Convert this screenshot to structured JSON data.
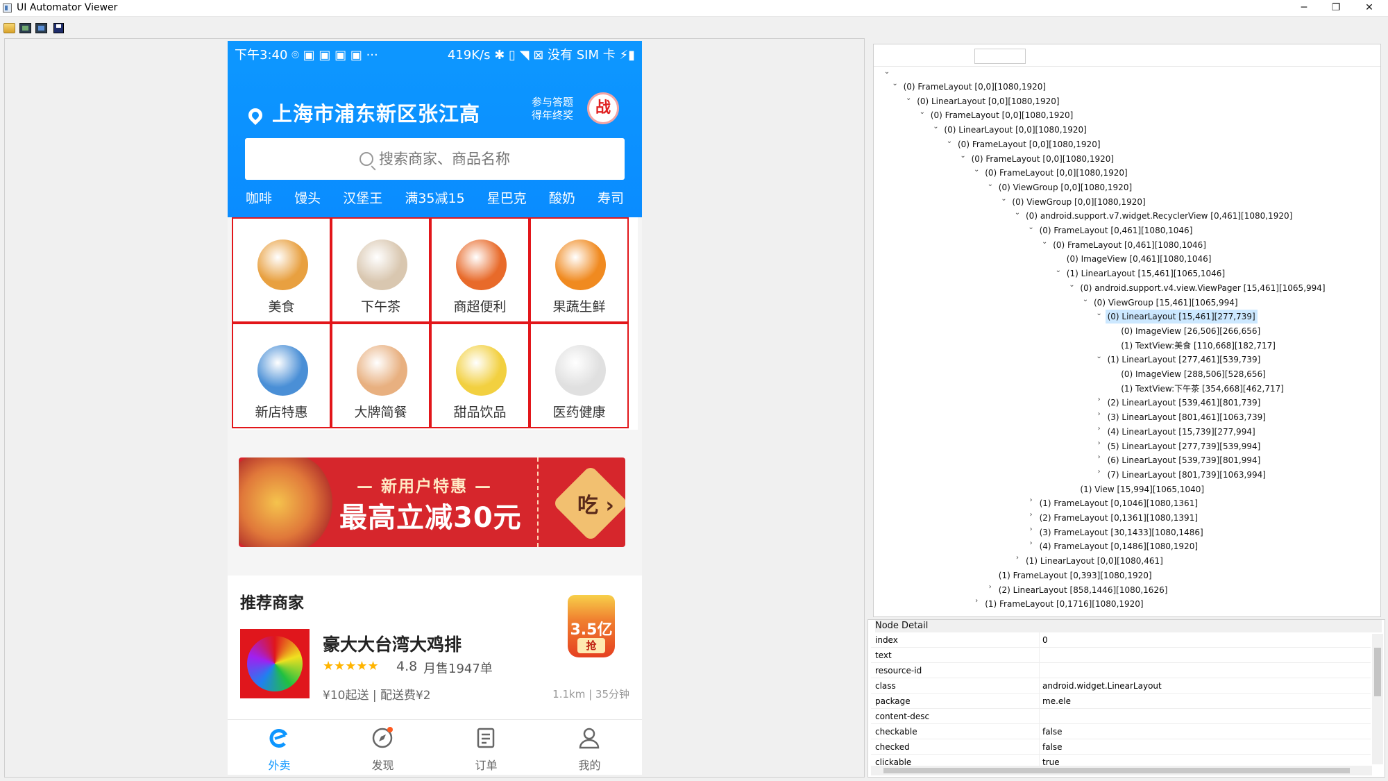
{
  "window": {
    "title": "UI Automator Viewer",
    "minimize": "─",
    "restore": "❐",
    "close": "✕"
  },
  "toolbar": {
    "icons": [
      "open-folder-icon",
      "device-screenshot-icon",
      "device-screenshot-compressed-icon",
      "save-icon"
    ]
  },
  "phone": {
    "status_left": "下午3:40  ⌾  ▣  ▣  ▣  ▣  ···",
    "status_right": "419K/s  ✱  ▯  ◥  ⊠  没有 SIM 卡  ⚡▮",
    "location": "上海市浦东新区张江高",
    "promo_line1": "参与答题",
    "promo_line2": "得年终奖",
    "promo_badge": "战",
    "search_placeholder": "搜索商家、商品名称",
    "hot_keywords": [
      "咖啡",
      "馒头",
      "汉堡王",
      "满35减15",
      "星巴克",
      "酸奶",
      "寿司"
    ],
    "categories": [
      {
        "label": "美食",
        "color": "#e8a040"
      },
      {
        "label": "下午茶",
        "color": "#d9c7b0"
      },
      {
        "label": "商超便利",
        "color": "#e86a2a"
      },
      {
        "label": "果蔬生鲜",
        "color": "#f08a20"
      },
      {
        "label": "新店特惠",
        "color": "#4a8fd6"
      },
      {
        "label": "大牌简餐",
        "color": "#e8b080"
      },
      {
        "label": "甜品饮品",
        "color": "#f2d040"
      },
      {
        "label": "医药健康",
        "color": "#e0e0e0"
      }
    ],
    "banner": {
      "sub": "— 新用户特惠 —",
      "main": "最高立减30元",
      "action": "吃 ›"
    },
    "recommend": {
      "title": "推荐商家",
      "shop_name": "豪大大台湾大鸡排",
      "stars": "★★★★★",
      "rating": "4.8",
      "sales": "月售1947单",
      "min_info": "¥10起送 | 配送费¥2",
      "distance": "1.1km | 35分钟",
      "redpacket_value": "3.5亿",
      "redpacket_action": "抢"
    },
    "tabs": [
      {
        "label": "外卖",
        "color": "#0d96ff"
      },
      {
        "label": "发现",
        "color": "#666666"
      },
      {
        "label": "订单",
        "color": "#666666"
      },
      {
        "label": "我的",
        "color": "#666666"
      }
    ]
  },
  "tree": {
    "root_toggle": "⌄",
    "nodes": [
      {
        "text": "(0) FrameLayout [0,0][1080,1920]",
        "depth": 1,
        "tw": "⌄"
      },
      {
        "text": "(0) LinearLayout [0,0][1080,1920]",
        "depth": 2,
        "tw": "⌄"
      },
      {
        "text": "(0) FrameLayout [0,0][1080,1920]",
        "depth": 3,
        "tw": "⌄"
      },
      {
        "text": "(0) LinearLayout [0,0][1080,1920]",
        "depth": 4,
        "tw": "⌄"
      },
      {
        "text": "(0) FrameLayout [0,0][1080,1920]",
        "depth": 5,
        "tw": "⌄"
      },
      {
        "text": "(0) FrameLayout [0,0][1080,1920]",
        "depth": 6,
        "tw": "⌄"
      },
      {
        "text": "(0) FrameLayout [0,0][1080,1920]",
        "depth": 7,
        "tw": "⌄"
      },
      {
        "text": "(0) ViewGroup [0,0][1080,1920]",
        "depth": 8,
        "tw": "⌄"
      },
      {
        "text": "(0) ViewGroup [0,0][1080,1920]",
        "depth": 9,
        "tw": "⌄"
      },
      {
        "text": "(0) android.support.v7.widget.RecyclerView [0,461][1080,1920]",
        "depth": 10,
        "tw": "⌄"
      },
      {
        "text": "(0) FrameLayout [0,461][1080,1046]",
        "depth": 11,
        "tw": "⌄"
      },
      {
        "text": "(0) FrameLayout [0,461][1080,1046]",
        "depth": 12,
        "tw": "⌄"
      },
      {
        "text": "(0) ImageView [0,461][1080,1046]",
        "depth": 13,
        "tw": ""
      },
      {
        "text": "(1) LinearLayout [15,461][1065,1046]",
        "depth": 13,
        "tw": "⌄"
      },
      {
        "text": "(0) android.support.v4.view.ViewPager [15,461][1065,994]",
        "depth": 14,
        "tw": "⌄"
      },
      {
        "text": "(0) ViewGroup [15,461][1065,994]",
        "depth": 15,
        "tw": "⌄"
      },
      {
        "text": "(0) LinearLayout [15,461][277,739]",
        "depth": 16,
        "tw": "⌄",
        "selected": true
      },
      {
        "text": "(0) ImageView [26,506][266,656]",
        "depth": 17,
        "tw": ""
      },
      {
        "text": "(1) TextView:美食 [110,668][182,717]",
        "depth": 17,
        "tw": ""
      },
      {
        "text": "(1) LinearLayout [277,461][539,739]",
        "depth": 16,
        "tw": "⌄"
      },
      {
        "text": "(0) ImageView [288,506][528,656]",
        "depth": 17,
        "tw": ""
      },
      {
        "text": "(1) TextView:下午茶 [354,668][462,717]",
        "depth": 17,
        "tw": ""
      },
      {
        "text": "(2) LinearLayout [539,461][801,739]",
        "depth": 16,
        "tw": "›"
      },
      {
        "text": "(3) LinearLayout [801,461][1063,739]",
        "depth": 16,
        "tw": "›"
      },
      {
        "text": "(4) LinearLayout [15,739][277,994]",
        "depth": 16,
        "tw": "›"
      },
      {
        "text": "(5) LinearLayout [277,739][539,994]",
        "depth": 16,
        "tw": "›"
      },
      {
        "text": "(6) LinearLayout [539,739][801,994]",
        "depth": 16,
        "tw": "›"
      },
      {
        "text": "(7) LinearLayout [801,739][1063,994]",
        "depth": 16,
        "tw": "›"
      },
      {
        "text": "(1) View [15,994][1065,1040]",
        "depth": 14,
        "tw": ""
      },
      {
        "text": "(1) FrameLayout [0,1046][1080,1361]",
        "depth": 11,
        "tw": "›"
      },
      {
        "text": "(2) FrameLayout [0,1361][1080,1391]",
        "depth": 11,
        "tw": "›"
      },
      {
        "text": "(3) FrameLayout [30,1433][1080,1486]",
        "depth": 11,
        "tw": "›"
      },
      {
        "text": "(4) FrameLayout [0,1486][1080,1920]",
        "depth": 11,
        "tw": "›"
      },
      {
        "text": "(1) LinearLayout [0,0][1080,461]",
        "depth": 10,
        "tw": "›"
      },
      {
        "text": "(1) FrameLayout [0,393][1080,1920]",
        "depth": 8,
        "tw": ""
      },
      {
        "text": "(2) LinearLayout [858,1446][1080,1626]",
        "depth": 8,
        "tw": "›"
      },
      {
        "text": "(1) FrameLayout [0,1716][1080,1920]",
        "depth": 7,
        "tw": "›"
      }
    ]
  },
  "detail": {
    "title": "Node Detail",
    "props": [
      {
        "k": "index",
        "v": "0"
      },
      {
        "k": "text",
        "v": ""
      },
      {
        "k": "resource-id",
        "v": ""
      },
      {
        "k": "class",
        "v": "android.widget.LinearLayout"
      },
      {
        "k": "package",
        "v": "me.ele"
      },
      {
        "k": "content-desc",
        "v": ""
      },
      {
        "k": "checkable",
        "v": "false"
      },
      {
        "k": "checked",
        "v": "false"
      },
      {
        "k": "clickable",
        "v": "true"
      }
    ]
  }
}
